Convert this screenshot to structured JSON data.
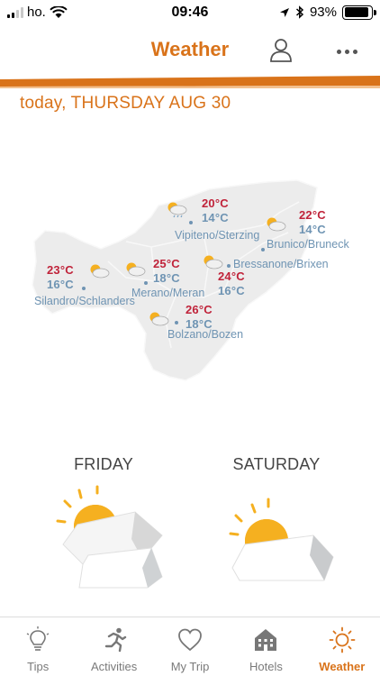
{
  "status_bar": {
    "carrier": "ho.",
    "time": "09:46",
    "battery": "93%"
  },
  "header": {
    "title": "Weather"
  },
  "date_title": "today, THURSDAY AUG 30",
  "map": {
    "towns": [
      {
        "name": "Vipiteno/Sterzing",
        "high": "20°C",
        "low": "14°C"
      },
      {
        "name": "Brunico/Bruneck",
        "high": "22°C",
        "low": "14°C"
      },
      {
        "name": "Silandro/Schlanders",
        "high": "23°C",
        "low": "16°C"
      },
      {
        "name": "Merano/Meran",
        "high": "25°C",
        "low": "18°C"
      },
      {
        "name": "Bressanone/Brixen",
        "high": "24°C",
        "low": "16°C"
      },
      {
        "name": "Bolzano/Bozen",
        "high": "26°C",
        "low": "18°C"
      }
    ]
  },
  "forecast": [
    {
      "day": "FRIDAY",
      "icon": "sun-behind-clouds-icon"
    },
    {
      "day": "SATURDAY",
      "icon": "sun-behind-cloud-icon"
    }
  ],
  "tabs": [
    {
      "label": "Tips",
      "icon": "lightbulb-icon"
    },
    {
      "label": "Activities",
      "icon": "running-person-icon"
    },
    {
      "label": "My Trip",
      "icon": "heart-icon"
    },
    {
      "label": "Hotels",
      "icon": "hotel-icon"
    },
    {
      "label": "Weather",
      "icon": "sun-icon",
      "active": true
    }
  ],
  "colors": {
    "accent": "#d9731a",
    "high_temp": "#c0233a",
    "low_temp": "#6f94b3",
    "map_fill": "#ececec"
  }
}
